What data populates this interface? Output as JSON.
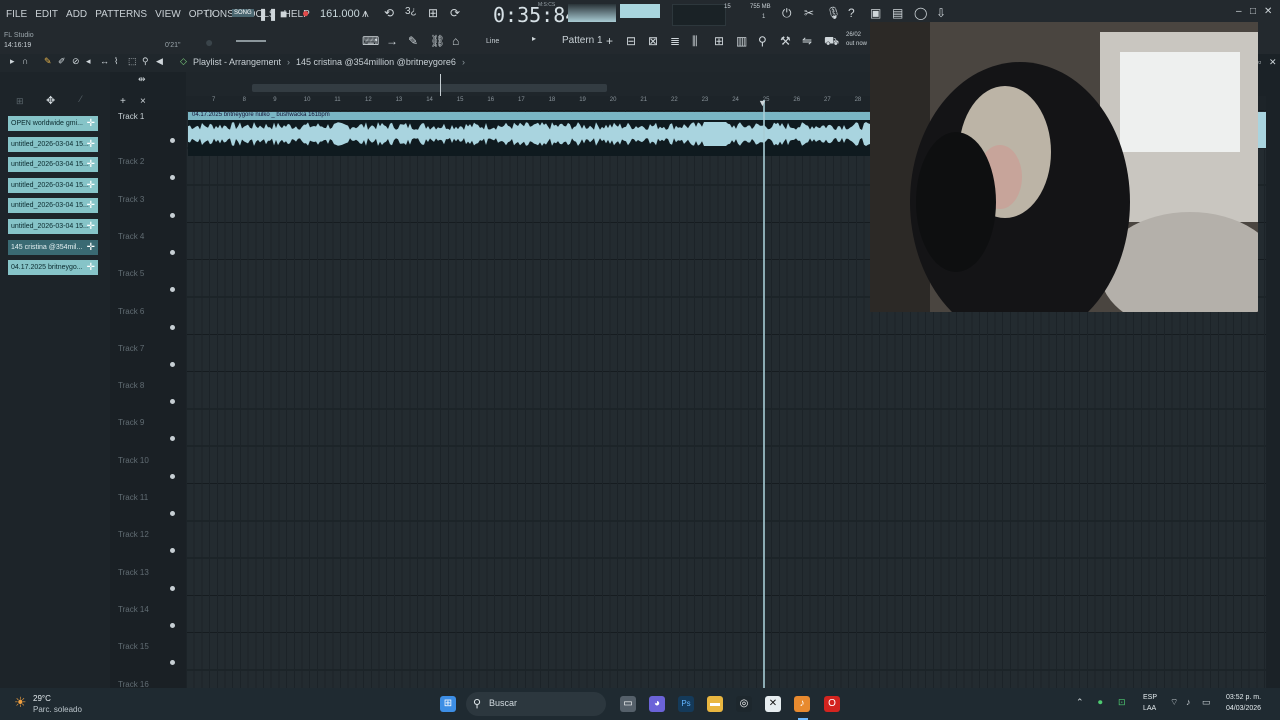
{
  "app": {
    "name": "FL Studio",
    "clock": "14:16:19",
    "short_time": "0'21\""
  },
  "menu": [
    "FILE",
    "EDIT",
    "ADD",
    "PATTERNS",
    "VIEW",
    "OPTIONS",
    "TOOLS",
    "HELP"
  ],
  "transport": {
    "mode": "SONG",
    "tempo": "161.000",
    "time": "0:35:84",
    "mscs": "M:S:CS",
    "cpu": "15",
    "ram": "755 MB",
    "ram_sub": "1"
  },
  "toolbar2": {
    "snap": "Line",
    "pattern": "Pattern 1",
    "date_short": "26/02",
    "out_now": "out now"
  },
  "playlist": {
    "title": "Playlist - Arrangement",
    "crumb": "145 cristina @354million @britneygore6"
  },
  "ruler_ticks": [
    "7",
    "8",
    "9",
    "10",
    "11",
    "12",
    "13",
    "14",
    "15",
    "16",
    "17",
    "18",
    "19",
    "20",
    "21",
    "22",
    "23",
    "24",
    "25",
    "26",
    "27",
    "28"
  ],
  "patterns": [
    "OPEN worldwide gmi...",
    "untitled_2026-03-04 15...",
    "untitled_2026-03-04 15...",
    "untitled_2026-03-04 15...",
    "untitled_2026-03-04 15...",
    "untitled_2026-03-04 15...",
    "145 cristina @354mil...",
    "04.17.2025 britneygo..."
  ],
  "tracks": [
    "Track 1",
    "Track 2",
    "Track 3",
    "Track 4",
    "Track 5",
    "Track 6",
    "Track 7",
    "Track 8",
    "Track 9",
    "Track 10",
    "Track 11",
    "Track 12",
    "Track 13",
    "Track 14",
    "Track 15",
    "Track 16"
  ],
  "clip": {
    "label": "04.17.2025 britneygore nulko _ bushwacka 161bpm"
  },
  "taskbar": {
    "temp": "29°C",
    "weather": "Parc. soleado",
    "search": "Buscar",
    "lang": "ESP",
    "lang2": "LAA",
    "time": "03:52 p. m.",
    "date": "04/03/2026"
  },
  "colors": {
    "accent": "#7ab5c3",
    "pattern": "#86c4c8",
    "bg": "#1b2227"
  }
}
